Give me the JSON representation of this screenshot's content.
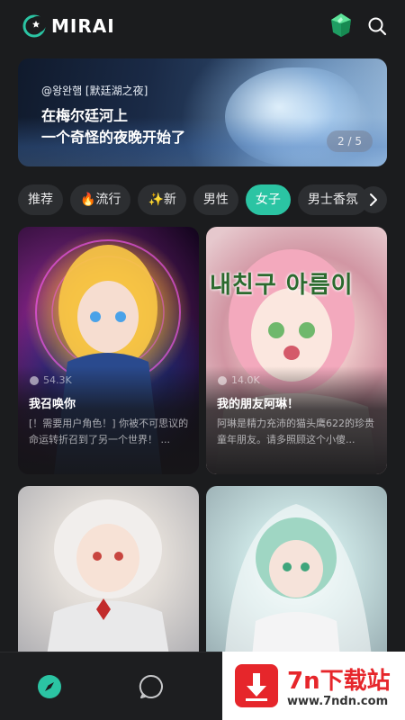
{
  "app": {
    "name": "MIRAI"
  },
  "header": {
    "logo_icon": "mirai-moon-logo-icon",
    "gem_icon": "green-gem-icon",
    "search_icon": "search-icon"
  },
  "banner": {
    "author": "@왕완햄 [默廷湖之夜]",
    "title_line1": "在梅尔廷河上",
    "title_line2": "一个奇怪的夜晚开始了",
    "pager": "2 / 5"
  },
  "tabs": [
    {
      "label": "推荐"
    },
    {
      "label": "🔥流行"
    },
    {
      "label": "✨新"
    },
    {
      "label": "男性"
    },
    {
      "label": "女子",
      "active": true
    },
    {
      "label": "男士香氛"
    }
  ],
  "cards": [
    {
      "count": "54.3K",
      "title": "我召唤你",
      "desc": "[！需要用户角色！] 你被不可思议的命运转折召到了另一个世界！ ..."
    },
    {
      "count": "14.0K",
      "title": "我的朋友阿琳！",
      "desc": "阿琳是精力充沛的猫头鹰622的珍贵童年朋友。请多照顾这个小傻...",
      "art_text": "내친구 아름이"
    },
    {
      "count": "",
      "title": "",
      "desc": ""
    },
    {
      "count": "",
      "title": "",
      "desc": ""
    }
  ],
  "watermark": {
    "title": "7n下载站",
    "url": "www.7ndn.com"
  },
  "colors": {
    "accent": "#2bc4a3",
    "background": "#1b1c1e",
    "chip": "#2c2e31"
  }
}
